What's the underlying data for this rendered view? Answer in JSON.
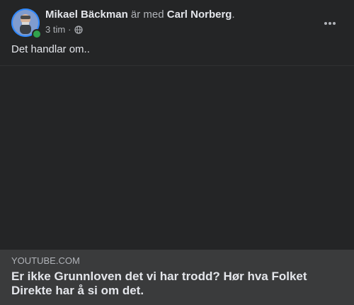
{
  "post": {
    "author": "Mikael Bäckman",
    "with_text": " är med ",
    "tagged": "Carl Norberg",
    "trailing": ".",
    "time": "3 tim",
    "separator": "·",
    "audience_icon": "globe-icon",
    "more_icon": "more-options-icon",
    "text": "Det handlar om.."
  },
  "link_preview": {
    "domain": "YOUTUBE.COM",
    "title": "Er ikke Grunnloven det vi har trodd? Hør hva Folket Direkte har å si om det."
  },
  "colors": {
    "background": "#242526",
    "preview_background": "#3a3b3c",
    "primary_text": "#e4e6eb",
    "secondary_text": "#b0b3b8",
    "online": "#31a24c",
    "avatar_ring": "#2d88ff"
  }
}
